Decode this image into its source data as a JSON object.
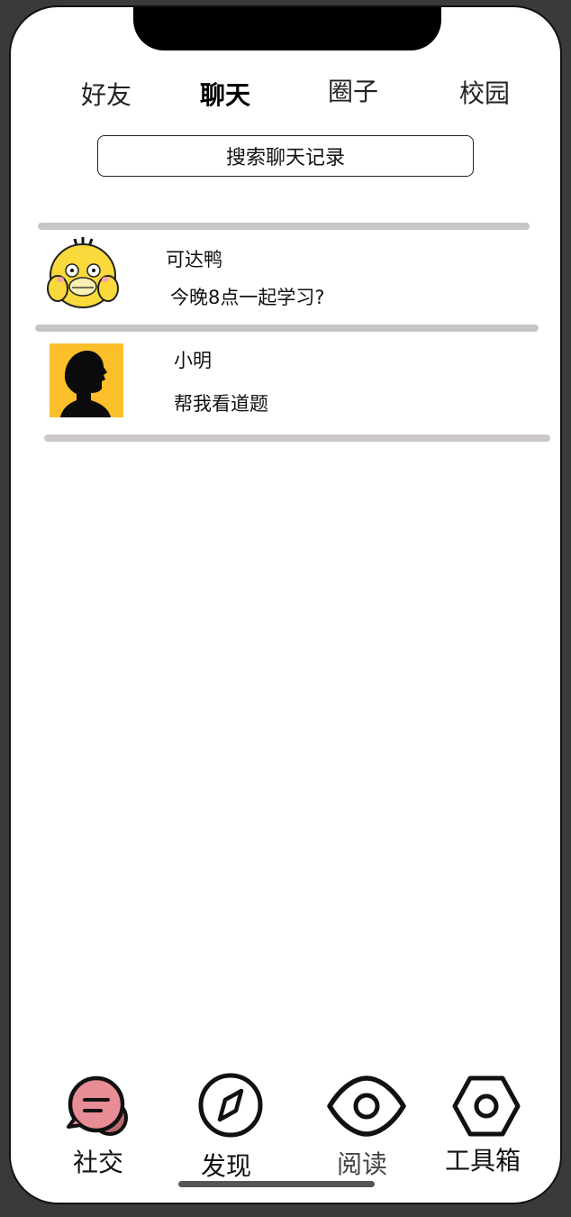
{
  "top_tabs": [
    {
      "label": "好友",
      "active": false
    },
    {
      "label": "聊天",
      "active": true
    },
    {
      "label": "圈子",
      "active": false
    },
    {
      "label": "校园",
      "active": false
    }
  ],
  "search": {
    "label": "搜索聊天记录"
  },
  "chats": [
    {
      "name": "可达鸭",
      "message": "今晚8点一起学习?",
      "avatar": "psyduck-avatar"
    },
    {
      "name": "小明",
      "message": "帮我看道题",
      "avatar": "silhouette-avatar"
    }
  ],
  "bottom_nav": [
    {
      "label": "社交",
      "icon": "chat-bubble-icon",
      "active": true
    },
    {
      "label": "发现",
      "icon": "compass-icon",
      "active": false
    },
    {
      "label": "阅读",
      "icon": "eye-icon",
      "active": false
    },
    {
      "label": "工具箱",
      "icon": "hex-nut-icon",
      "active": false
    }
  ],
  "colors": {
    "accent": "#e88d96",
    "divider": "#c6c6c8",
    "avatar_yellow": "#fbbf2b"
  }
}
